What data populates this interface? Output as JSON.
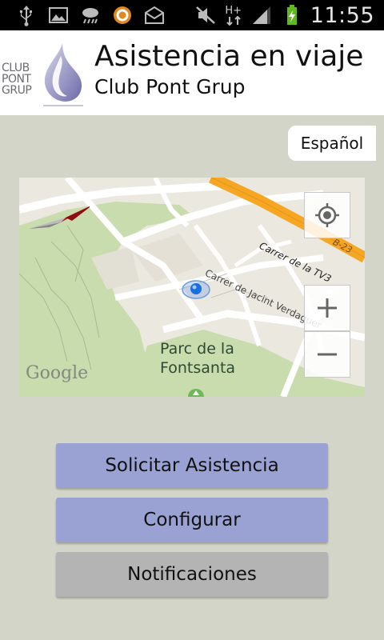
{
  "status_bar": {
    "time": "11:55",
    "network_type": "H+",
    "icons_left": [
      "usb-icon",
      "image-icon",
      "weather-icon",
      "app-icon",
      "email-icon"
    ],
    "icons_right": [
      "mute-icon",
      "network-icon",
      "signal-icon",
      "battery-icon"
    ]
  },
  "header": {
    "logo_lines": [
      "CLUB",
      "PONT",
      "GRUP"
    ],
    "title": "Asistencia en viaje",
    "subtitle": "Club Pont Grup"
  },
  "language": {
    "label": "Español"
  },
  "map": {
    "park_label_line1": "Parc de la",
    "park_label_line2": "Fontsanta",
    "street_1": "Carrer de Jacint Verdaguer",
    "street_2": "Carrer de la TV3",
    "street_3": "B-23",
    "attribution": "Google",
    "zoom_in_label": "+",
    "zoom_out_label": "−"
  },
  "actions": {
    "solicitar": "Solicitar Asistencia",
    "configurar": "Configurar",
    "notificaciones": "Notificaciones"
  },
  "colors": {
    "background": "#d4d5c9",
    "primary_button": "#9aa2d3",
    "secondary_button": "#b4b4b4",
    "highway": "#f5a623",
    "park": "#c8dcae"
  }
}
